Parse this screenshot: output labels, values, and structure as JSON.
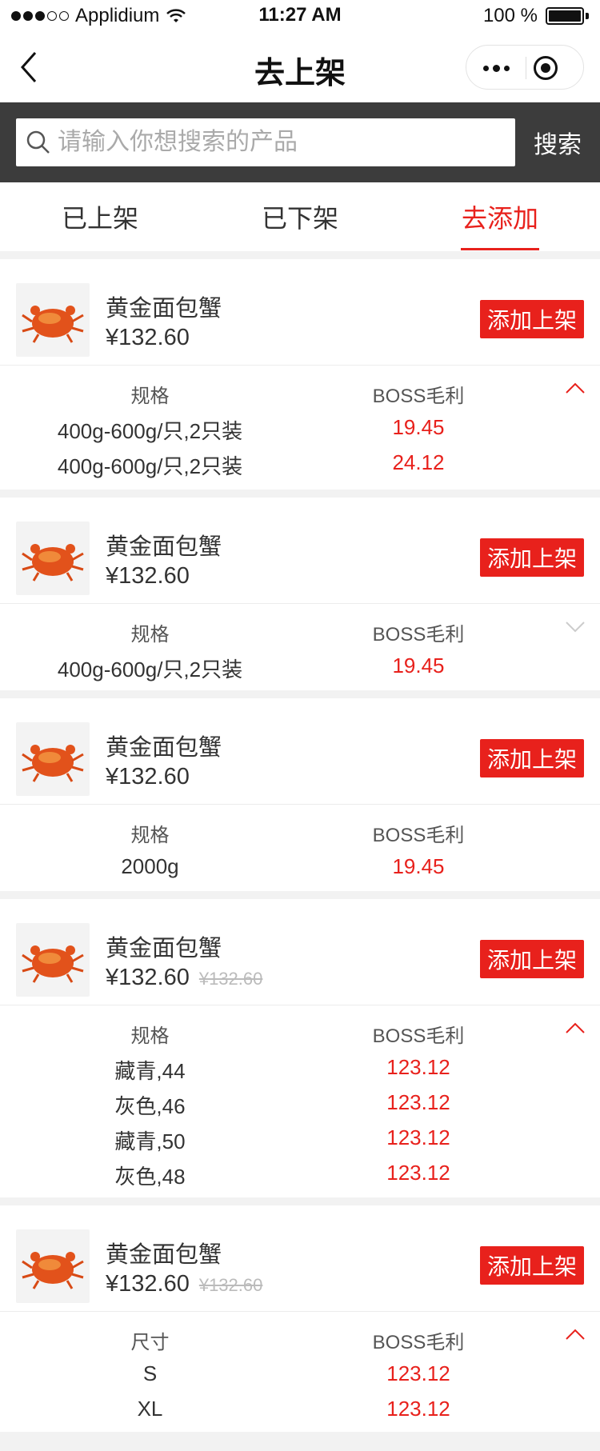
{
  "status_bar": {
    "carrier": "Applidium",
    "time": "11:27 AM",
    "battery": "100 %"
  },
  "nav": {
    "title": "去上架"
  },
  "search": {
    "placeholder": "请输入你想搜索的产品",
    "button_label": "搜索"
  },
  "tabs": [
    {
      "label": "已上架",
      "active": false
    },
    {
      "label": "已下架",
      "active": false
    },
    {
      "label": "去添加",
      "active": true
    }
  ],
  "add_button_label": "添加上架",
  "products": [
    {
      "name": "黄金面包蟹",
      "price": "¥132.60",
      "original_price": "",
      "spec_header": "规格",
      "profit_header": "BOSS毛利",
      "expanded": true,
      "specs": [
        {
          "spec": "400g-600g/只,2只装",
          "profit": "19.45"
        },
        {
          "spec": "400g-600g/只,2只装",
          "profit": "24.12"
        }
      ]
    },
    {
      "name": "黄金面包蟹",
      "price": "¥132.60",
      "original_price": "",
      "spec_header": "规格",
      "profit_header": "BOSS毛利",
      "expanded": false,
      "specs": [
        {
          "spec": "400g-600g/只,2只装",
          "profit": "19.45"
        }
      ]
    },
    {
      "name": "黄金面包蟹",
      "price": "¥132.60",
      "original_price": "",
      "spec_header": "规格",
      "profit_header": "BOSS毛利",
      "expanded": null,
      "specs": [
        {
          "spec": "2000g",
          "profit": "19.45"
        }
      ]
    },
    {
      "name": "黄金面包蟹",
      "price": "¥132.60",
      "original_price": "¥132.60",
      "spec_header": "规格",
      "profit_header": "BOSS毛利",
      "expanded": true,
      "specs": [
        {
          "spec": "藏青,44",
          "profit": "123.12"
        },
        {
          "spec": "灰色,46",
          "profit": "123.12"
        },
        {
          "spec": "藏青,50",
          "profit": "123.12"
        },
        {
          "spec": "灰色,48",
          "profit": "123.12"
        }
      ]
    },
    {
      "name": "黄金面包蟹",
      "price": "¥132.60",
      "original_price": "¥132.60",
      "spec_header": "尺寸",
      "profit_header": "BOSS毛利",
      "expanded": true,
      "specs": [
        {
          "spec": "S",
          "profit": "123.12"
        },
        {
          "spec": "XL",
          "profit": "123.12"
        }
      ]
    }
  ],
  "colors": {
    "accent": "#e8211c",
    "search_bg": "#3c3c3c",
    "page_bg": "#f2f2f2"
  }
}
